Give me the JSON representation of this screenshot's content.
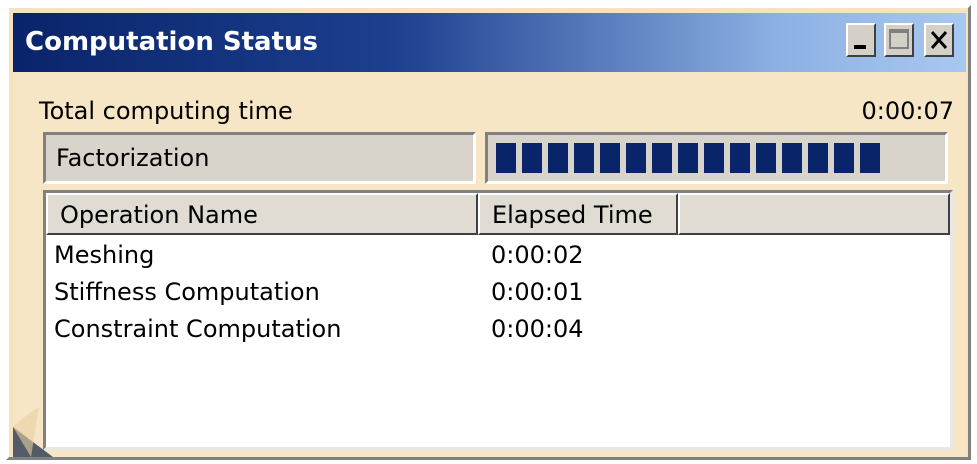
{
  "window": {
    "title": "Computation Status",
    "controls": {
      "minimize_icon": "minimize-icon",
      "maximize_icon": "maximize-icon",
      "close_icon": "close-icon"
    }
  },
  "summary": {
    "total_label": "Total computing time",
    "total_value": "0:00:07"
  },
  "current_phase": {
    "label": "Factorization",
    "progress_fraction": 0.87
  },
  "table": {
    "columns": [
      "Operation Name",
      "Elapsed Time"
    ],
    "rows": [
      {
        "operation": "Meshing",
        "elapsed": "0:00:02"
      },
      {
        "operation": "Stiffness Computation",
        "elapsed": "0:00:01"
      },
      {
        "operation": "Constraint Computation",
        "elapsed": "0:00:04"
      }
    ]
  },
  "colors": {
    "title_gradient_start": "#0a246a",
    "title_gradient_end": "#a8c8f0",
    "progress_fill": "#0a246a",
    "window_background": "#f5e2bf"
  }
}
